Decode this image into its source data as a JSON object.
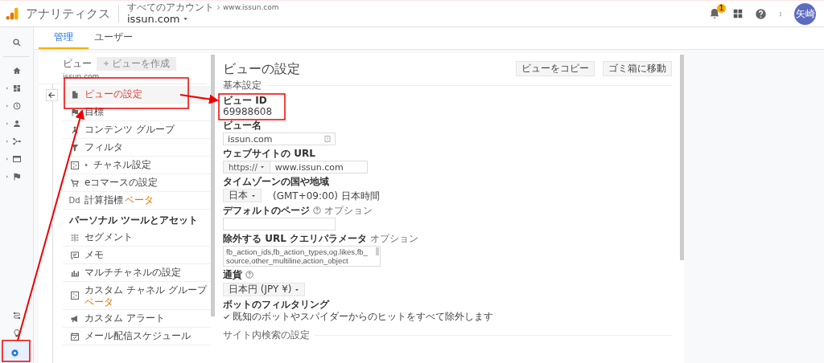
{
  "header": {
    "app_name": "アナリティクス",
    "breadcrumb_account": "すべてのアカウント",
    "breadcrumb_property": "www.issun.com",
    "property": "issun.com",
    "notification_count": "1",
    "avatar": "矢崎"
  },
  "rail": [
    {
      "kind": "search",
      "expandable": false,
      "selected": false
    },
    {
      "kind": "home",
      "expandable": false,
      "selected": false
    },
    {
      "kind": "dashboard",
      "expandable": true,
      "selected": false
    },
    {
      "kind": "clock",
      "expandable": true,
      "selected": false
    },
    {
      "kind": "person",
      "expandable": true,
      "selected": false
    },
    {
      "kind": "branch",
      "expandable": true,
      "selected": false
    },
    {
      "kind": "window",
      "expandable": true,
      "selected": false
    },
    {
      "kind": "flag",
      "expandable": true,
      "selected": false
    },
    {
      "kind": "route",
      "expandable": false,
      "selected": false
    },
    {
      "kind": "bulb",
      "expandable": false,
      "selected": false
    },
    {
      "kind": "gear",
      "expandable": false,
      "selected": true
    }
  ],
  "tabs": [
    {
      "label": "管理",
      "selected": true
    },
    {
      "label": "ユーザー",
      "selected": false
    }
  ],
  "view_column": {
    "label": "ビュー",
    "create_button": "ビューを作成",
    "view_name": "issun.com",
    "items": [
      {
        "kind": "item",
        "label": "ビューの設定",
        "selected": true,
        "has_children": false
      },
      {
        "kind": "item",
        "label": "目標",
        "selected": false,
        "has_children": false
      },
      {
        "kind": "item",
        "label": "コンテンツ グループ",
        "selected": false,
        "has_children": false
      },
      {
        "kind": "item",
        "label": "フィルタ",
        "selected": false,
        "has_children": false
      },
      {
        "kind": "item",
        "label": "チャネル設定",
        "selected": false,
        "has_children": true
      },
      {
        "kind": "item",
        "label": "eコマースの設定",
        "selected": false,
        "has_children": false
      },
      {
        "kind": "item",
        "glyph": "Dd",
        "label": "計算指標",
        "badge": "ベータ",
        "selected": false,
        "has_children": false
      },
      {
        "kind": "section",
        "label": "パーソナル ツールとアセット"
      },
      {
        "kind": "item",
        "label": "セグメント",
        "selected": false,
        "has_children": false
      },
      {
        "kind": "item",
        "label": "メモ",
        "selected": false,
        "has_children": false
      },
      {
        "kind": "item",
        "label": "マルチチャネルの設定",
        "selected": false,
        "has_children": false
      },
      {
        "kind": "item",
        "label": "カスタム チャネル グループ",
        "badge": "ベータ",
        "badge_below": true,
        "selected": false,
        "has_children": false
      },
      {
        "kind": "item",
        "label": "カスタム アラート",
        "selected": false,
        "has_children": false
      },
      {
        "kind": "item",
        "label": "メール配信スケジュール",
        "selected": false,
        "has_children": false
      }
    ]
  },
  "settings": {
    "title": "ビューの設定",
    "buttons": [
      "ビューをコピー",
      "ゴミ箱に移動"
    ],
    "section": "基本設定",
    "fields": [
      {
        "kind": "static",
        "label": "ビュー ID",
        "value": "69988608"
      },
      {
        "kind": "text",
        "label": "ビュー名",
        "value": "issun.com",
        "help": false
      },
      {
        "kind": "url",
        "label": "ウェブサイトの URL",
        "protocol": "https://",
        "value": "www.issun.com"
      },
      {
        "kind": "timezone",
        "label": "タイムゾーンの国や地域",
        "country": "日本",
        "zone": "(GMT+09:00) 日本時間"
      },
      {
        "kind": "text",
        "label": "デフォルトのページ",
        "help": true,
        "note": "オプション"
      },
      {
        "kind": "textarea",
        "label": "除外する URL クエリパラメータ",
        "note": "オプション",
        "value": "fb_action_ids,fb_action_types,og.likes,fb_source,other_multiline,action_object"
      },
      {
        "kind": "select",
        "label": "通貨",
        "help": true,
        "value": "日本円 (JPY ¥)"
      },
      {
        "kind": "checkbox",
        "label": "ボットのフィルタリング",
        "text": "既知のボットやスパイダーからのヒットをすべて除外します",
        "checked": true
      }
    ],
    "next_section": "サイト内検索の設定"
  }
}
